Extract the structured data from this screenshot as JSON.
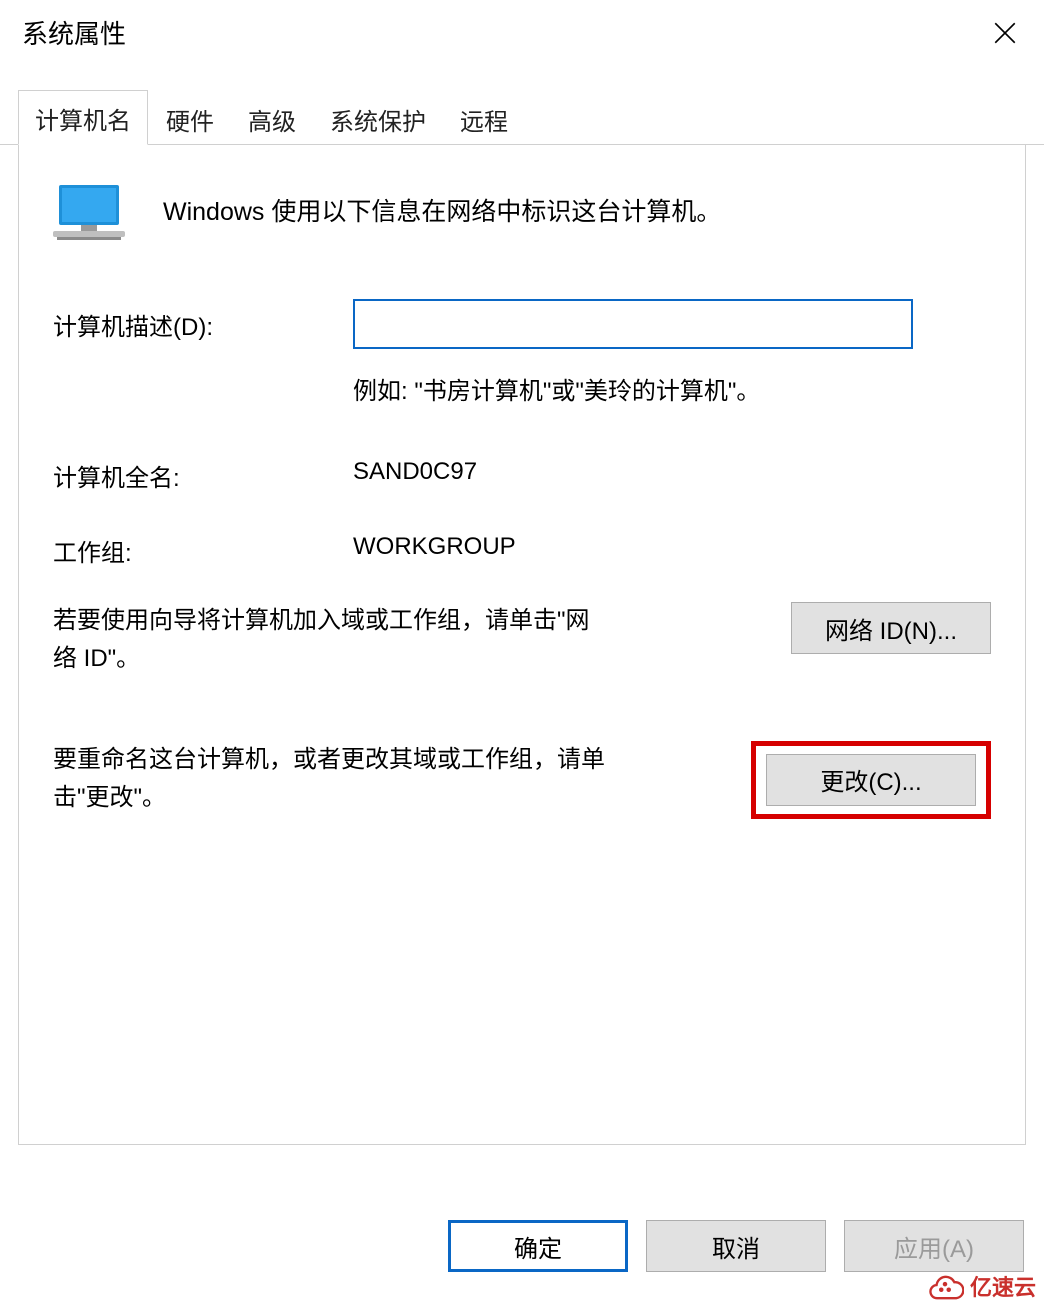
{
  "window": {
    "title": "系统属性"
  },
  "tabs": [
    {
      "label": "计算机名"
    },
    {
      "label": "硬件"
    },
    {
      "label": "高级"
    },
    {
      "label": "系统保护"
    },
    {
      "label": "远程"
    }
  ],
  "intro": "Windows 使用以下信息在网络中标识这台计算机。",
  "description": {
    "label": "计算机描述(D):",
    "value": "",
    "example": "例如: \"书房计算机\"或\"美玲的计算机\"。"
  },
  "full_name": {
    "label": "计算机全名:",
    "value": "SAND0C97"
  },
  "workgroup": {
    "label": "工作组:",
    "value": "WORKGROUP"
  },
  "network_id": {
    "text": "若要使用向导将计算机加入域或工作组，请单击\"网络 ID\"。",
    "button": "网络 ID(N)..."
  },
  "change": {
    "text": "要重命名这台计算机，或者更改其域或工作组，请单击\"更改\"。",
    "button": "更改(C)..."
  },
  "footer": {
    "ok": "确定",
    "cancel": "取消",
    "apply": "应用(A)"
  },
  "watermark": "亿速云"
}
